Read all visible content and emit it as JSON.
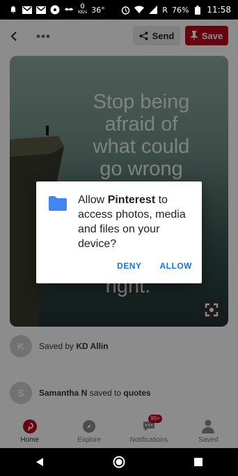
{
  "status_bar": {
    "left_icons": [
      "bell-icon",
      "gmail-icon",
      "gmail-icon",
      "pinwheel-icon",
      "mustache-icon"
    ],
    "network_speed": "0",
    "network_unit": "KB/s",
    "temperature": "36°",
    "right_icons": [
      "alarm-icon",
      "wifi-icon",
      "signal-icon"
    ],
    "roaming": "R",
    "battery": "76%",
    "time": "11:58"
  },
  "top_bar": {
    "send_label": "Send",
    "save_label": "Save"
  },
  "pin": {
    "quote_lines": [
      "Stop being",
      "afraid of",
      "what could",
      "go wrong"
    ],
    "quote_tail": "right."
  },
  "rows": [
    {
      "avatar": "K",
      "prefix": "Saved by ",
      "name": "KD Allin"
    },
    {
      "avatar": "S",
      "prefix": "Samantha N",
      "middle": " saved to ",
      "board": "quotes"
    }
  ],
  "bottom_nav": {
    "items": [
      {
        "label": "Home",
        "icon": "pinterest-icon",
        "active": true
      },
      {
        "label": "Explore",
        "icon": "compass-icon",
        "active": false
      },
      {
        "label": "Notifications",
        "icon": "chat-icon",
        "badge": "99+",
        "active": false
      },
      {
        "label": "Saved",
        "icon": "person-icon",
        "active": false
      }
    ]
  },
  "dialog": {
    "text_pre": "Allow ",
    "text_app": "Pinterest",
    "text_post": " to access photos, media and files on your device?",
    "deny_label": "DENY",
    "allow_label": "ALLOW"
  },
  "colors": {
    "brand_red": "#bd081c",
    "dialog_button": "#1976d2",
    "folder_icon": "#4285f4"
  }
}
